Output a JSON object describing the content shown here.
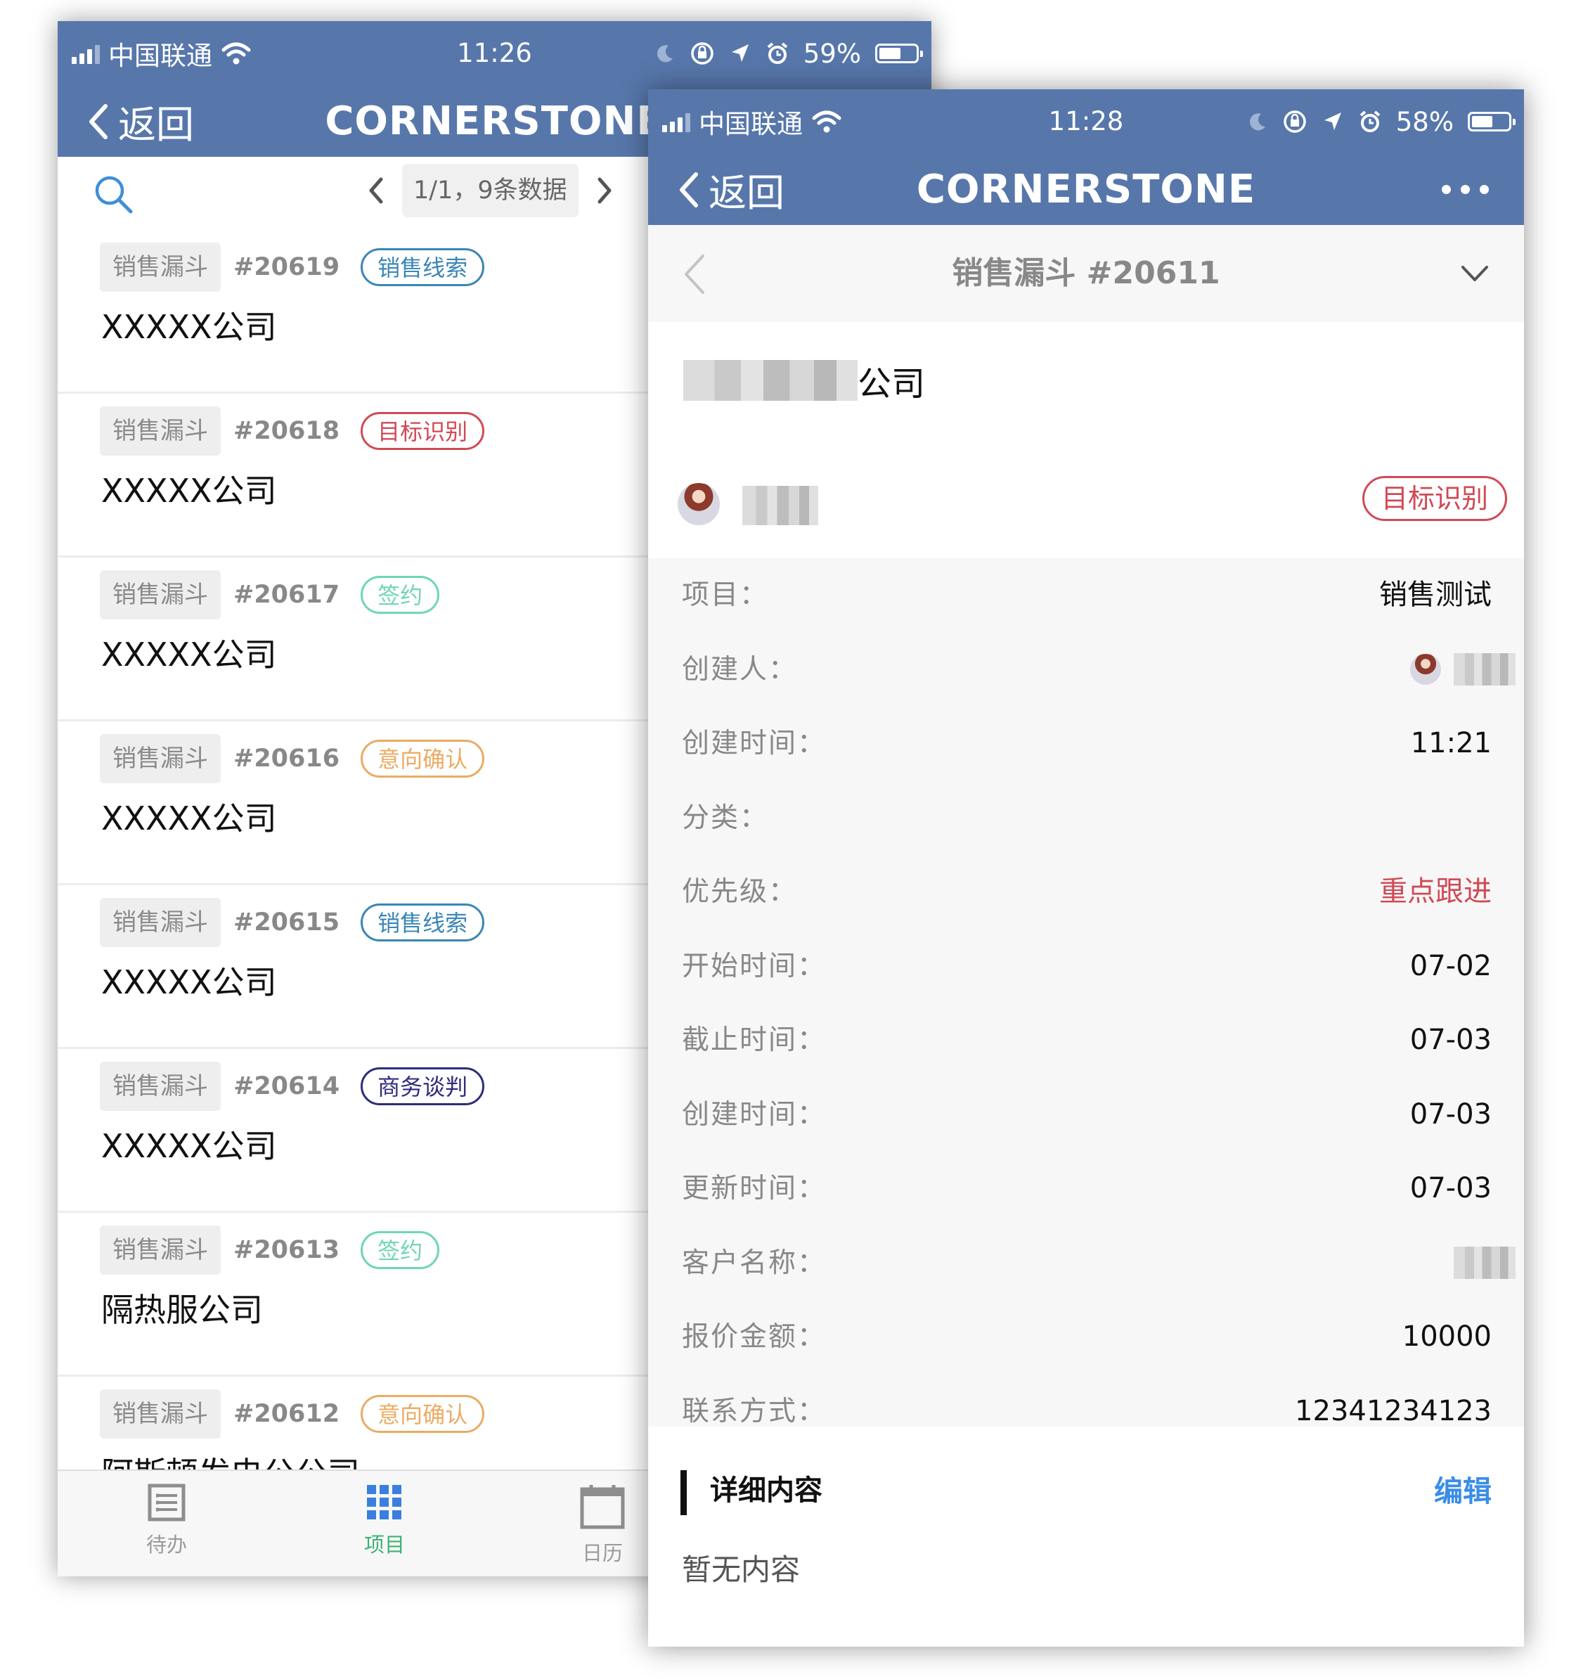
{
  "listScreen": {
    "status": {
      "carrier": "中国联通",
      "time": "11:26",
      "battery": "59%",
      "batteryLevel": 0.59
    },
    "nav": {
      "back": "返回",
      "title": "CORNERSTONE"
    },
    "toolbar": {
      "pageInfo": "1/1，9条数据"
    },
    "items": [
      {
        "type": "销售漏斗",
        "id": "#20619",
        "stage": "销售线索",
        "color": "#3a86b5",
        "name": "XXXXX公司"
      },
      {
        "type": "销售漏斗",
        "id": "#20618",
        "stage": "目标识别",
        "color": "#d04a55",
        "name": "XXXXX公司"
      },
      {
        "type": "销售漏斗",
        "id": "#20617",
        "stage": "签约",
        "color": "#6fd6b2",
        "name": "XXXXX公司"
      },
      {
        "type": "销售漏斗",
        "id": "#20616",
        "stage": "意向确认",
        "color": "#e9ac63",
        "name": "XXXXX公司"
      },
      {
        "type": "销售漏斗",
        "id": "#20615",
        "stage": "销售线索",
        "color": "#3a86b5",
        "name": "XXXXX公司"
      },
      {
        "type": "销售漏斗",
        "id": "#20614",
        "stage": "商务谈判",
        "color": "#2e2c7d",
        "name": "XXXXX公司"
      },
      {
        "type": "销售漏斗",
        "id": "#20613",
        "stage": "签约",
        "color": "#6fd6b2",
        "name": "隔热服公司"
      },
      {
        "type": "销售漏斗",
        "id": "#20612",
        "stage": "意向确认",
        "color": "#e9ac63",
        "name": "阿斯顿发电公公司"
      }
    ],
    "tabs": [
      {
        "label": "待办",
        "icon": "list-icon",
        "active": false
      },
      {
        "label": "项目",
        "icon": "grid-icon",
        "active": true
      },
      {
        "label": "日历",
        "icon": "calendar-icon",
        "active": false
      }
    ]
  },
  "detailScreen": {
    "status": {
      "carrier": "中国联通",
      "time": "11:28",
      "battery": "58%",
      "batteryLevel": 0.58
    },
    "nav": {
      "back": "返回",
      "title": "CORNERSTONE"
    },
    "breadcrumb": "销售漏斗 #20611",
    "companySuffix": "公司",
    "stage": "目标识别",
    "fields": [
      {
        "label": "项目：",
        "value": "销售测试"
      },
      {
        "label": "创建人：",
        "value": ""
      },
      {
        "label": "创建时间：",
        "value": "11:21"
      },
      {
        "label": "分类：",
        "value": ""
      },
      {
        "label": "优先级：",
        "value": "重点跟进"
      },
      {
        "label": "开始时间：",
        "value": "07-02"
      },
      {
        "label": "截止时间：",
        "value": "07-03"
      },
      {
        "label": "创建时间：",
        "value": "07-03"
      },
      {
        "label": "更新时间：",
        "value": "07-03"
      },
      {
        "label": "客户名称：",
        "value": ""
      },
      {
        "label": "报价金额：",
        "value": "10000"
      },
      {
        "label": "联系方式：",
        "value": "12341234123"
      }
    ],
    "details": {
      "heading": "详细内容",
      "edit": "编辑",
      "empty": "暂无内容"
    }
  },
  "colors": {
    "header": "#5777ab",
    "accentGreen": "#3cb371",
    "danger": "#d04a55",
    "link": "#3a8ee6"
  }
}
